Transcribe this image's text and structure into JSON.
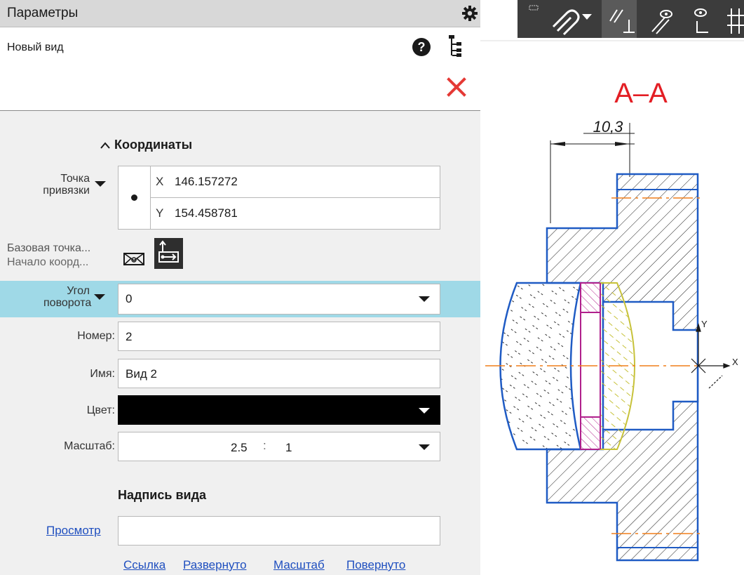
{
  "panel": {
    "title": "Параметры",
    "mode_title": "Новый вид"
  },
  "coordinates": {
    "section_label": "Координаты",
    "anchor_label_line1": "Точка",
    "anchor_label_line2": "привязки",
    "x_axis": "X",
    "x_value": "146.157272",
    "y_axis": "Y",
    "y_value": "154.458781"
  },
  "base_point": {
    "label_line1": "Базовая точка...",
    "label_line2": "Начало коорд..."
  },
  "rotation": {
    "label_line1": "Угол",
    "label_line2": "поворота",
    "value": "0"
  },
  "number": {
    "label": "Номер:",
    "value": "2"
  },
  "name": {
    "label": "Имя:",
    "value": "Вид 2"
  },
  "color": {
    "label": "Цвет:",
    "swatch": "#000000"
  },
  "scale": {
    "label": "Масштаб:",
    "numerator": "2.5",
    "separator": ":",
    "denominator": "1"
  },
  "view_label": {
    "heading": "Надпись вида",
    "preview_link": "Просмотр",
    "options": [
      "Ссылка",
      "Развернуто",
      "Масштаб",
      "Повернуто"
    ]
  },
  "drawing": {
    "section_title": "А–А",
    "dimension": "10,3",
    "axis_x": "X",
    "axis_y": "Y"
  },
  "colors": {
    "accent_highlight": "#9fd9e7",
    "close_red": "#e53935",
    "link_blue": "#1f4fbf",
    "drawing_blue": "#1f5bc4",
    "title_red": "#e31e24",
    "center_orange": "#f07f1a"
  }
}
